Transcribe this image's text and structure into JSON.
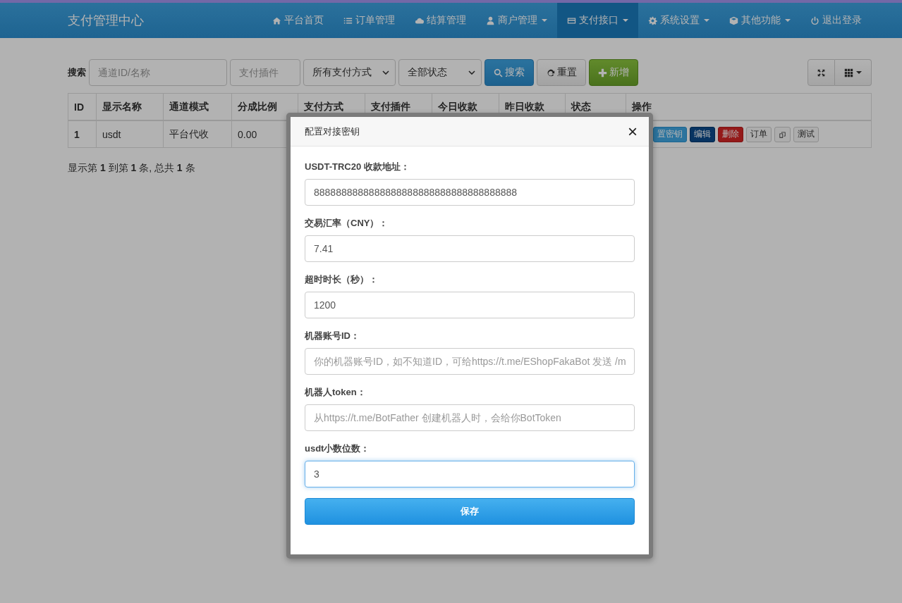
{
  "nav": {
    "brand": "支付管理中心",
    "items": [
      {
        "label": "平台首页",
        "dropdown": false,
        "selected": false
      },
      {
        "label": "订单管理",
        "dropdown": false,
        "selected": false
      },
      {
        "label": "结算管理",
        "dropdown": false,
        "selected": false
      },
      {
        "label": "商户管理",
        "dropdown": true,
        "selected": false
      },
      {
        "label": "支付接口",
        "dropdown": true,
        "selected": true
      },
      {
        "label": "系统设置",
        "dropdown": true,
        "selected": false
      },
      {
        "label": "其他功能",
        "dropdown": true,
        "selected": false
      },
      {
        "label": "退出登录",
        "dropdown": false,
        "selected": false
      }
    ]
  },
  "toolbar": {
    "label": "搜索",
    "fields": [
      {
        "kind": "input",
        "placeholder": "通道ID/名称"
      },
      {
        "kind": "input",
        "placeholder": "支付插件"
      },
      {
        "kind": "select",
        "value": "所有支付方式"
      },
      {
        "kind": "select",
        "value": "全部状态"
      }
    ],
    "buttons": [
      {
        "kind": "primary",
        "label": "搜索"
      },
      {
        "kind": "default",
        "label": "重置"
      },
      {
        "kind": "success",
        "label": "新增"
      }
    ]
  },
  "table": {
    "columns": [
      "ID",
      "显示名称",
      "通道模式",
      "分成比例",
      "支付方式",
      "支付插件",
      "今日收款",
      "昨日收款",
      "状态",
      "操作"
    ],
    "rows": [
      {
        "cells": [
          "1",
          "usdt",
          "平台代收",
          "0.00"
        ],
        "actions": [
          {
            "kind": "info",
            "label": "置密钥"
          },
          {
            "kind": "navy",
            "label": "编辑"
          },
          {
            "kind": "danger",
            "label": "删除"
          },
          {
            "kind": "default",
            "label": "订单"
          },
          {
            "kind": "copy"
          },
          {
            "kind": "default",
            "label": "测试"
          }
        ]
      }
    ]
  },
  "pagination": "显示第 **1** 到第 **1** 条, 总共 **1** 条",
  "modal": {
    "title": "配置对接密钥",
    "close": "×",
    "fields": [
      {
        "label": "USDT-TRC20 收款地址：",
        "value": "8888888888888888888888888888888888888",
        "focused": false
      },
      {
        "label": "交易汇率（CNY）：",
        "value": "7.41",
        "focused": false
      },
      {
        "label": "超时时长（秒）：",
        "value": "1200",
        "focused": false
      },
      {
        "label": "机器账号ID：",
        "placeholder": "你的机器账号ID，如不知道ID，可给https://t.me/EShopFakaBot 发送 /m",
        "focused": false
      },
      {
        "label": "机器人token：",
        "placeholder": "从https://t.me/BotFather 创建机器人时，会给你BotToken",
        "focused": false
      },
      {
        "label": "usdt小数位数：",
        "value": "3",
        "focused": true
      }
    ],
    "submit": "保存"
  }
}
